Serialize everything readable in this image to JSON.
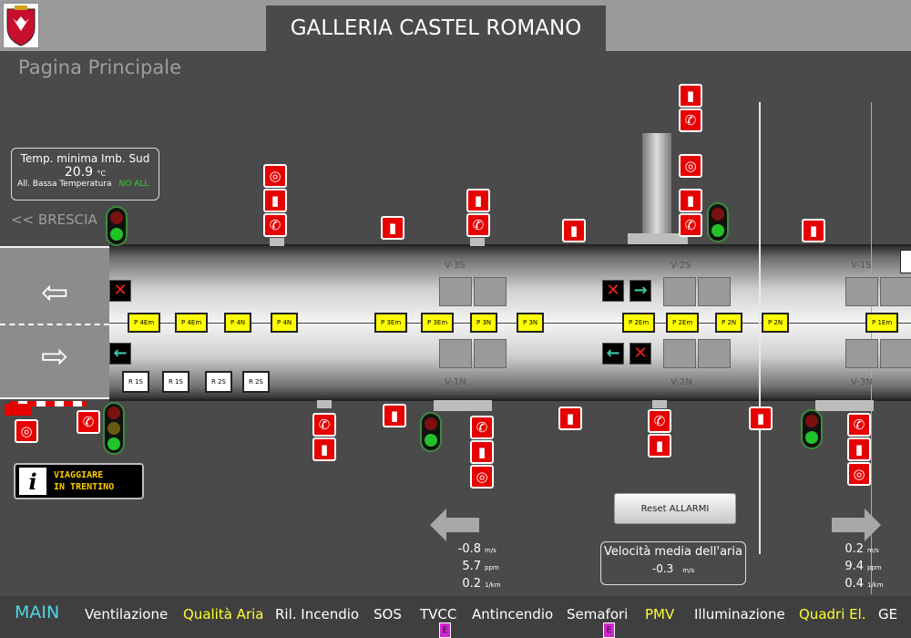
{
  "header": {
    "title": "GALLERIA CASTEL ROMANO"
  },
  "page": {
    "subtitle": "Pagina Principale"
  },
  "temperature": {
    "label": "Temp. minima Imb. Sud",
    "value": "20.9",
    "unit": "°C",
    "alarm_label": "All. Bassa Temperatura",
    "alarm_status": "NO ALL"
  },
  "direction": {
    "label": "<< BRESCIA"
  },
  "fans": [
    "V-3S",
    "V-2S",
    "V-1S",
    "V-1N",
    "V-2N",
    "V-3N"
  ],
  "p_upper": [
    "P 4Em",
    "P 4Em",
    "P 4N",
    "P 4N",
    "P 3Em",
    "P 3Em",
    "P 3N",
    "P 3N",
    "P 2Em",
    "P 2Em",
    "P 2N",
    "P 2N",
    "P 1Em"
  ],
  "r_boxes": [
    "R 1S",
    "R 1S",
    "R 2S",
    "R 2S"
  ],
  "info": {
    "line1": "VIAGGIARE",
    "line2": "IN TRENTINO"
  },
  "reset": {
    "label": "Reset ALLARMI"
  },
  "air_speed": {
    "label": "Velocità media dell'aria",
    "value": "-0.3",
    "unit": "m/s"
  },
  "left_meas": [
    {
      "value": "-0.8",
      "unit": "m/s"
    },
    {
      "value": "5.7",
      "unit": "ppm"
    },
    {
      "value": "0.2",
      "unit": "1/km"
    }
  ],
  "right_meas": [
    {
      "value": "0.2",
      "unit": "m/s"
    },
    {
      "value": "9.4",
      "unit": "ppm"
    },
    {
      "value": "0.4",
      "unit": "1/km"
    }
  ],
  "nav": {
    "main": "MAIN",
    "ventilazione": "Ventilazione",
    "qualita": "Qualità Aria",
    "incendio": "Ril. Incendio",
    "sos": "SOS",
    "tvcc": "TVCC",
    "antincendio": "Antincendio",
    "semafori": "Semafori",
    "pmv": "PMV",
    "illuminazione": "Illuminazione",
    "quadri": "Quadri El.",
    "ge": "GE",
    "badge": "E"
  },
  "colors": {
    "alarm_red": "#e60000",
    "panel_yellow": "#ffff00",
    "nav_accent": "#4fd8e8"
  }
}
